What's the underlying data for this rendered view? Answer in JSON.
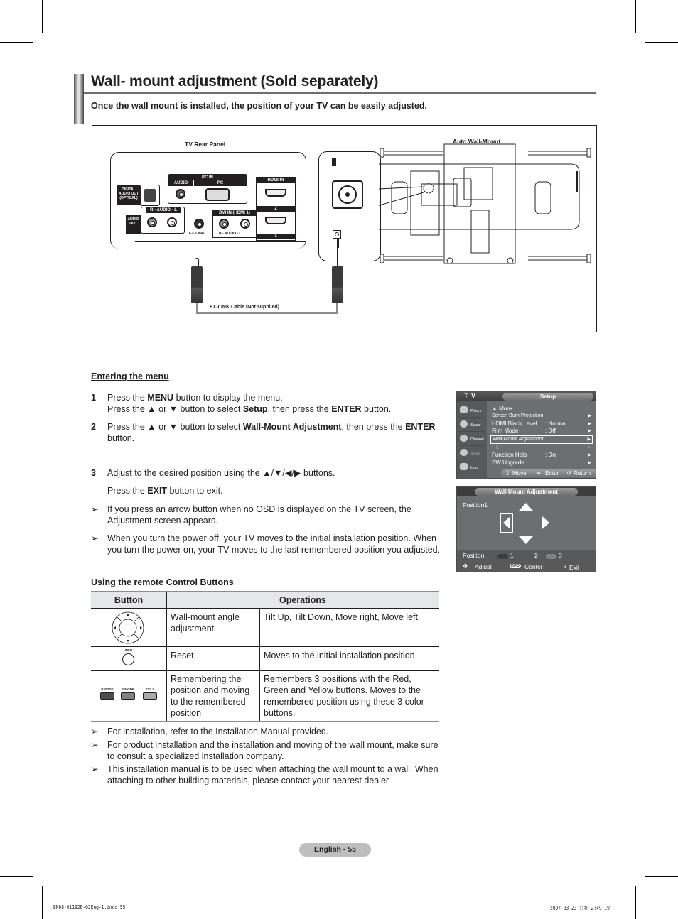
{
  "page": {
    "title": "Wall- mount adjustment (Sold separately)",
    "subtitle": "Once the wall mount is installed, the position of your TV can be easily adjusted."
  },
  "figure": {
    "rear_panel_label": "TV Rear Panel",
    "auto_wall_mount_label": "Auto Wall-Mount",
    "cable_label": "EX-LINK Cable (Not supplied)",
    "ports": {
      "pc_in": "PC IN",
      "audio": "AUDIO",
      "pc": "PC",
      "hdmi_in": "HDMI IN",
      "hdmi_2": "2",
      "hdmi_1": "1",
      "digital_audio_out": "DIGITAL AUDIO OUT (OPTICAL)",
      "audio_out": "AUDIO OUT",
      "audio_rl": "R - AUDIO - L",
      "ex_link": "EX-LINK",
      "dvi_in": "DVI IN (HDMI 1)",
      "dvi_audio": "R - AUDIO - L"
    }
  },
  "instructions": {
    "section_heading": "Entering the menu",
    "steps": [
      {
        "num": "1",
        "parts": [
          {
            "t": "Press the "
          },
          {
            "t": "MENU",
            "b": true
          },
          {
            "t": " button to display the menu."
          },
          {
            "br": true
          },
          {
            "t": "Press the ▲ or ▼ button to select "
          },
          {
            "t": "Setup",
            "b": true
          },
          {
            "t": ", then press the "
          },
          {
            "t": "ENTER",
            "b": true
          },
          {
            "t": " button."
          }
        ]
      },
      {
        "num": "2",
        "parts": [
          {
            "t": "Press the ▲ or ▼ button to select "
          },
          {
            "t": "Wall-Mount Adjustment",
            "b": true
          },
          {
            "t": ", then press the "
          },
          {
            "t": "ENTER",
            "b": true
          },
          {
            "t": " button."
          }
        ]
      },
      {
        "num": "3",
        "parts": [
          {
            "t": "Adjust to the desired position using the ▲/▼/◀/▶ buttons."
          }
        ]
      }
    ],
    "exit_line": [
      {
        "t": "Press the "
      },
      {
        "t": "EXIT",
        "b": true
      },
      {
        "t": " button to exit."
      }
    ],
    "notes": [
      "If you press an arrow button when no OSD is displayed on the TV screen, the Adjustment screen appears.",
      "When you turn the power off, your TV moves to the initial installation position. When you turn the power on, your TV moves to the last remembered position you adjusted."
    ],
    "note_marker": "➢"
  },
  "remote_section": {
    "heading": "Using the remote Control Buttons",
    "table": {
      "headers": [
        "Button",
        "Operations"
      ],
      "rows": [
        {
          "button": "direction-pad",
          "function": "Wall-mount angle adjustment",
          "operation": "Tilt Up, Tilt Down, Move right, Move left"
        },
        {
          "button": "info-button",
          "button_label": "INFO",
          "function": "Reset",
          "operation": "Moves to the initial installation position"
        },
        {
          "button": "color-buttons",
          "button_labels": [
            "P.MODE",
            "S.MODE",
            "STILL"
          ],
          "function": "Remembering the position and moving to the remembered position",
          "operation": "Remembers 3 positions with the Red, Green and Yellow buttons. Moves to the remembered position using these 3 color buttons."
        }
      ]
    }
  },
  "closing_notes": [
    "For installation, refer to the Installation Manual provided.",
    "For product installation and the installation and moving of the wall mount, make sure to consult a specialized installation company.",
    "This installation manual is to be used when attaching the wall mount to a wall. When attaching to other building materials, please contact your nearest dealer"
  ],
  "osd_setup_menu": {
    "header_left": "T V",
    "header_tab": "Setup",
    "sidebar": [
      "Picture",
      "Sound",
      "Channel",
      "Setup",
      "Input"
    ],
    "rows": [
      {
        "label": "▲ More",
        "value": "",
        "arrow": false
      },
      {
        "label": "Screen Burn Protection",
        "value": "",
        "arrow": true
      },
      {
        "label": "HDMI Black Level",
        "value": ": Normal",
        "arrow": true
      },
      {
        "label": "Film Mode",
        "value": ": Off",
        "arrow": true
      },
      {
        "label": "Wall-Mount Adjustment",
        "value": "",
        "arrow": true,
        "selected": true
      },
      {
        "label": "PIP",
        "value": "",
        "arrow": true,
        "disabled": true
      },
      {
        "label": "Function Help",
        "value": ": On",
        "arrow": true
      },
      {
        "label": "SW Upgrade",
        "value": "",
        "arrow": true
      }
    ],
    "footer": {
      "move": "Move",
      "enter": "Enter",
      "return": "Return"
    }
  },
  "osd_wall_mount": {
    "title": "Wall-Mount Adjustment",
    "current_position": "Position1",
    "selected_direction": "left",
    "position_label": "Position",
    "positions": [
      "1",
      "2",
      "3"
    ],
    "footer": {
      "adjust": "Adjust",
      "info": "INFO",
      "center": "Center",
      "exit": "Exit"
    }
  },
  "footer": {
    "page_label": "English - 55",
    "slug_left": "BN68-01192E-02Eng-1.indd   55",
    "slug_right": "2007-03-23   ｿｧﾈﾄ 2:49:19"
  },
  "colors": {
    "text": "#231f20",
    "rule": "#6d6e71",
    "osd_bg": "#6d6e71",
    "table_header": "#e6e7e8",
    "badge": "#bcbec0",
    "pmode": "#4d4d4f",
    "smode": "#808285",
    "still": "#a7a9ac"
  }
}
